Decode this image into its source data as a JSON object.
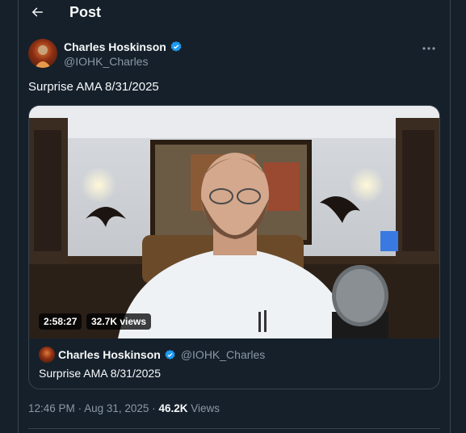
{
  "header": {
    "title": "Post"
  },
  "author": {
    "name": "Charles Hoskinson",
    "handle": "@IOHK_Charles",
    "verified": true
  },
  "post": {
    "text": "Surprise AMA 8/31/2025"
  },
  "video": {
    "duration": "2:58:27",
    "views": "32.7K views"
  },
  "quote": {
    "name": "Charles Hoskinson",
    "handle": "@IOHK_Charles",
    "text": "Surprise AMA 8/31/2025"
  },
  "meta": {
    "time": "12:46 PM",
    "sep": "·",
    "date": "Aug 31, 2025",
    "views_count": "46.2K",
    "views_label": "Views"
  },
  "colors": {
    "background": "#15202b",
    "verified": "#1d9bf0",
    "secondary_text": "#8b98a5",
    "border": "#38444d"
  },
  "icons": [
    "back-arrow-icon",
    "verified-badge-icon",
    "more-options-icon"
  ]
}
